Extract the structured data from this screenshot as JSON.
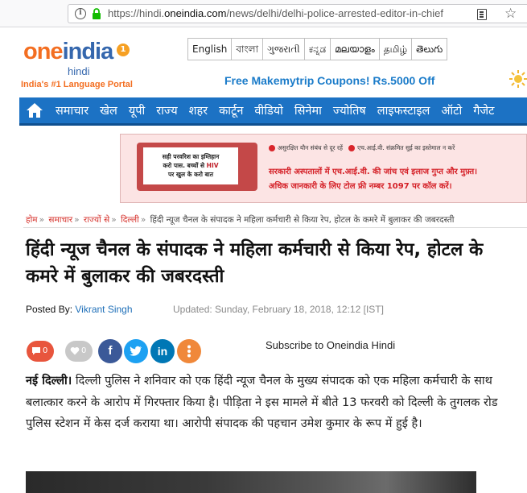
{
  "browser": {
    "url_prefix": "https://hindi.",
    "url_domain": "oneindia.com",
    "url_path": "/news/delhi/delhi-police-arrested-editor-in-chief"
  },
  "header": {
    "logo_one": "one",
    "logo_india": "india",
    "logo_badge": "1",
    "logo_sub": "hindi",
    "tagline": "India's #1 Language Portal",
    "languages": [
      "English",
      "বাংলা",
      "ગુજરાતી",
      "ಕನ್ನಡ",
      "മലയാളം",
      "தமிழ்",
      "తెలుగు"
    ],
    "promo": "Free Makemytrip Coupons! Rs.5000 Off"
  },
  "nav": {
    "items": [
      "समाचार",
      "खेल",
      "यूपी",
      "राज्य",
      "शहर",
      "कार्टून",
      "वीडियो",
      "सिनेमा",
      "ज्योतिष",
      "लाइफस्टाइल",
      "ऑटो",
      "गैजेट"
    ]
  },
  "ad": {
    "tv_line1": "सही परवरिश का इम्तिहान",
    "tv_line2a": "करो पास. बच्चों से ",
    "tv_line2b": "HIV",
    "tv_line3": "पर खुल के करो बात",
    "info1": "असुरक्षित यौन संबंध से दूर रहें",
    "info2": "एच.आई.वी. संक्रमित सुई का इस्तेमाल न करें",
    "line2": "सरकारी अस्पतालों में एच.आई.वी. की जांच एवं इलाज गुप्त और मुफ़्त।",
    "line3": "अधिक जानकारी के लिए टोल फ्री नम्बर 1097 पर कॉल करें।"
  },
  "breadcrumb": {
    "items": [
      "होम",
      "समाचार",
      "राज्यों से",
      "दिल्ली"
    ],
    "current": "हिंदी न्यूज चैनल के संपादक ने महिला कर्मचारी से किया रेप, होटल के कमरे में बुलाकर की जबरदस्ती"
  },
  "article": {
    "title": "हिंदी न्यूज चैनल के संपादक ने महिला कर्मचारी से किया रेप, होटल के कमरे में बुलाकर की जबरदस्ती",
    "posted_by_label": "Posted By: ",
    "author": "Vikrant Singh",
    "updated": "Updated: Sunday, February 18, 2018, 12:12 [IST]",
    "dateline": "नई दिल्ली।",
    "body": " दिल्ली पुलिस ने शनिवार को एक हिंदी न्यूज चैनल के मुख्य संपादक को एक महिला कर्मचारी के साथ बलात्कार करने के आरोप में गिरफ्तार किया है। पीड़िता ने इस मामले में बीते 13 फरवरी को दिल्ली के तुगलक रोड पुलिस स्टेशन में केस दर्ज कराया था। आरोपी संपादक की पहचान उमेश कुमार के रूप में हुई है।"
  },
  "share": {
    "reactions_count": "0",
    "likes_count": "0",
    "subscribe_text": "Subscribe to Oneindia Hindi",
    "colors": {
      "reactions": "#e8553d",
      "likes": "#c8c8c8",
      "facebook": "#3b5998",
      "twitter": "#1da1f2",
      "linkedin": "#0077b5",
      "more": "#f0883a"
    }
  }
}
